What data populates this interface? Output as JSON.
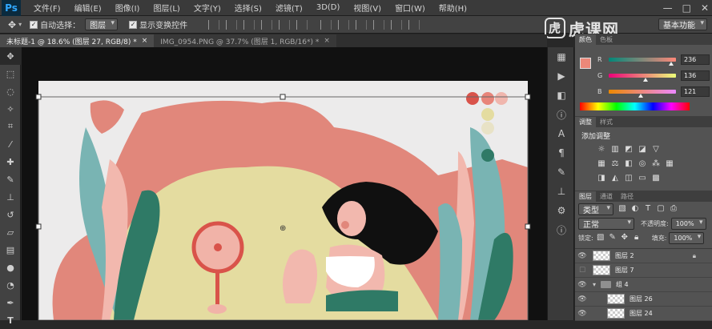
{
  "app": {
    "logo": "Ps"
  },
  "menu": [
    "文件(F)",
    "编辑(E)",
    "图像(I)",
    "图层(L)",
    "文字(Y)",
    "选择(S)",
    "滤镜(T)",
    "3D(D)",
    "视图(V)",
    "窗口(W)",
    "帮助(H)"
  ],
  "window_controls": [
    "—",
    "□",
    "✕"
  ],
  "options": {
    "auto_select_label": "自动选择：",
    "auto_select_target": "图层",
    "show_transform_label": "显示变换控件",
    "workspace": "基本功能"
  },
  "tabs": [
    {
      "label": "未标题-1 @ 18.6% (图层 27, RGB/8) *",
      "close": "×"
    },
    {
      "label": "IMG_0954.PNG @ 37.7% (图层 1, RGB/16*) *",
      "close": "×"
    }
  ],
  "watermark": "虎课网",
  "color_panel": {
    "tabs": [
      "颜色",
      "色板"
    ],
    "r_label": "R",
    "r_value": "236",
    "g_label": "G",
    "g_value": "136",
    "b_label": "B",
    "b_value": "121",
    "foreground": "#ec8879"
  },
  "adjust_panel": {
    "tabs": [
      "调整",
      "样式"
    ],
    "title": "添加调整"
  },
  "layers_panel": {
    "tabs": [
      "图层",
      "通道",
      "路径"
    ],
    "filter_kind": "类型",
    "blend_mode": "正常",
    "opacity_label": "不透明度:",
    "opacity_value": "100%",
    "lock_label": "锁定:",
    "fill_label": "填充:",
    "fill_value": "100%",
    "layers": [
      {
        "name": "图层 2",
        "visible": true,
        "locked": true
      },
      {
        "name": "图层 7",
        "visible": false
      },
      {
        "name": "组 4",
        "visible": true,
        "group": true
      },
      {
        "name": "图层 26",
        "visible": true
      },
      {
        "name": "图层 24",
        "visible": true
      }
    ]
  },
  "palette": [
    "#d9534a",
    "#e8857a",
    "#f0b6ad",
    "#e4dca0",
    "#e8e2c6",
    "#2f7a66"
  ]
}
